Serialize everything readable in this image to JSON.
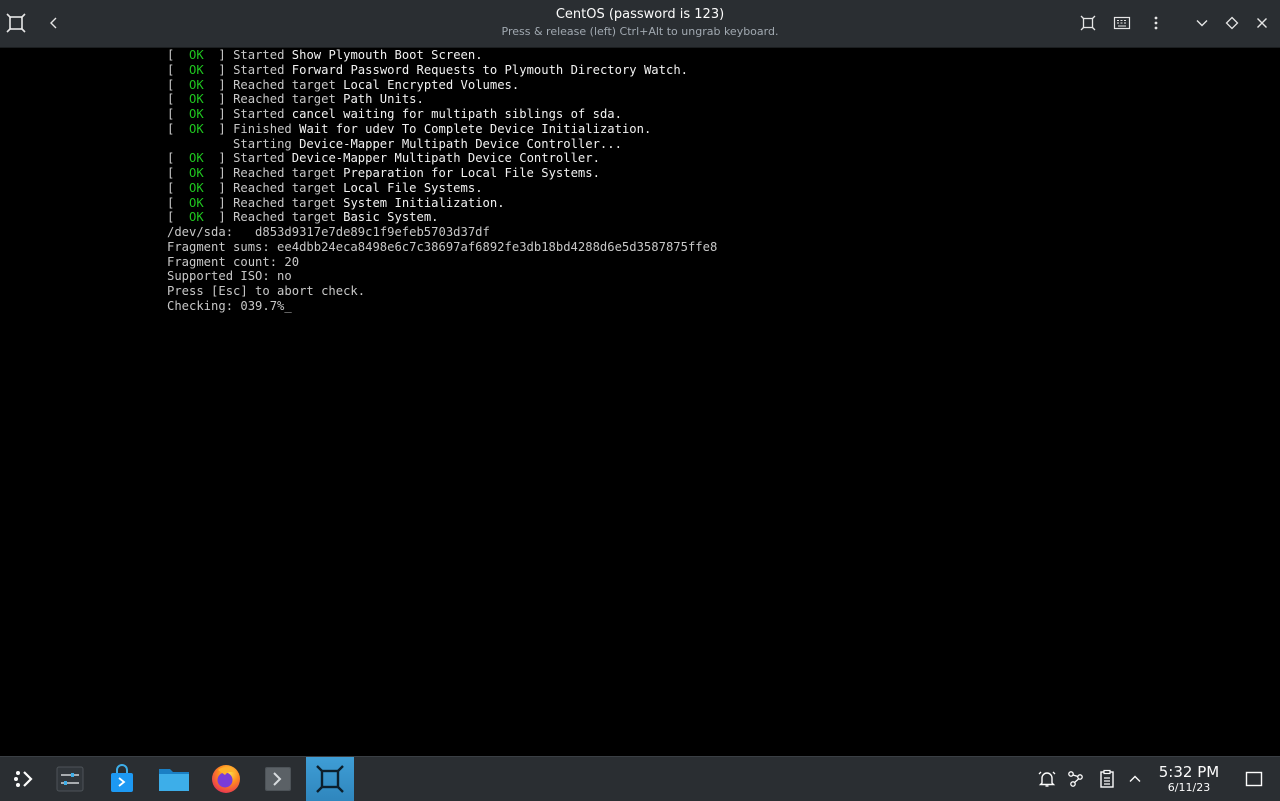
{
  "window": {
    "title": "CentOS (password is 123)",
    "subtitle": "Press & release (left) Ctrl+Alt to ungrab keyboard."
  },
  "titlebar_buttons": {
    "app_icon": "app-switcher-icon",
    "back": "chevron-left-icon",
    "fit": "fit-screen-icon",
    "keyboard": "keyboard-icon",
    "menu": "kebab-menu-icon",
    "minimize": "chevron-down-icon",
    "keep_above": "diamond-icon",
    "close": "close-icon"
  },
  "console": {
    "lines": [
      {
        "status": "OK",
        "verb": "Started",
        "text": "Show Plymouth Boot Screen."
      },
      {
        "status": "OK",
        "verb": "Started",
        "text": "Forward Password Requests to Plymouth Directory Watch."
      },
      {
        "status": "OK",
        "verb": "Reached target",
        "text": "Local Encrypted Volumes."
      },
      {
        "status": "OK",
        "verb": "Reached target",
        "text": "Path Units."
      },
      {
        "status": "OK",
        "verb": "Started",
        "text": "cancel waiting for multipath siblings of sda."
      },
      {
        "status": "OK",
        "verb": "Finished",
        "text": "Wait for udev To Complete Device Initialization."
      },
      {
        "status": "",
        "verb": "Starting",
        "text": "Device-Mapper Multipath Device Controller..."
      },
      {
        "status": "OK",
        "verb": "Started",
        "text": "Device-Mapper Multipath Device Controller."
      },
      {
        "status": "OK",
        "verb": "Reached target",
        "text": "Preparation for Local File Systems."
      },
      {
        "status": "OK",
        "verb": "Reached target",
        "text": "Local File Systems."
      },
      {
        "status": "OK",
        "verb": "Reached target",
        "text": "System Initialization."
      },
      {
        "status": "OK",
        "verb": "Reached target",
        "text": "Basic System."
      }
    ],
    "plain_lines": [
      "/dev/sda:   d853d9317e7de89c1f9efeb5703d37df",
      "Fragment sums: ee4dbb24eca8498e6c7c38697af6892fe3db18bd4288d6e5d3587875ffe8",
      "Fragment count: 20",
      "Supported ISO: no",
      "Press [Esc] to abort check."
    ],
    "progress_line": "Checking: 039.7%",
    "cursor": "_"
  },
  "taskbar": {
    "items": [
      {
        "name": "application-launcher",
        "icon": "launcher-icon"
      },
      {
        "name": "system-settings",
        "icon": "settings-sliders-icon"
      },
      {
        "name": "discover-store",
        "icon": "store-bag-icon"
      },
      {
        "name": "dolphin-files",
        "icon": "folder-icon"
      },
      {
        "name": "firefox",
        "icon": "firefox-icon"
      },
      {
        "name": "konsole",
        "icon": "terminal-icon"
      },
      {
        "name": "boxes-vm",
        "icon": "vm-frame-icon"
      }
    ],
    "tray": [
      "notifications-icon",
      "network-icon",
      "clipboard-icon",
      "expand-tray-icon"
    ],
    "clock": {
      "time": "5:32 PM",
      "date": "6/11/23"
    },
    "show_desktop_icon": "show-desktop-icon"
  },
  "colors": {
    "ok": "#1fc51f",
    "console_text": "#c8c8c8",
    "accent": "#3daee9",
    "panel": "#2a2e32"
  }
}
